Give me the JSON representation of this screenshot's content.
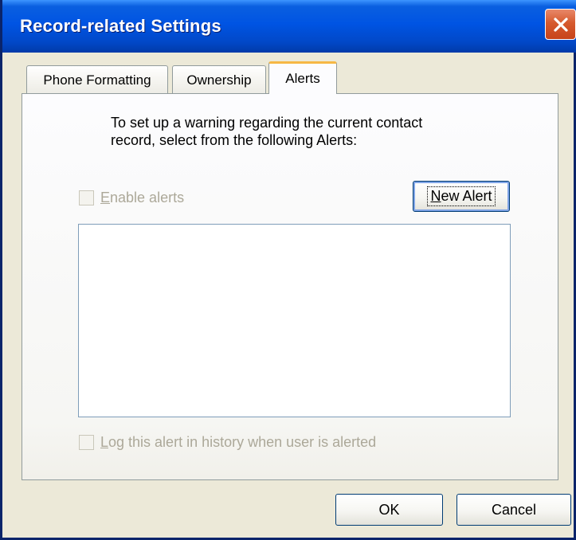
{
  "window": {
    "title": "Record-related Settings",
    "close_icon": "close-icon",
    "title_color": "#0054e3",
    "close_color": "#d65a2e"
  },
  "tabs": [
    {
      "label": "Phone Formatting",
      "active": false
    },
    {
      "label": "Ownership",
      "active": false
    },
    {
      "label": "Alerts",
      "active": true
    }
  ],
  "alerts": {
    "description_line1": "To set up a warning regarding the current contact",
    "description_line2": "record, select from the following Alerts:",
    "enable_alerts": {
      "label_mnemonic": "E",
      "label_rest": "nable alerts",
      "checked": false,
      "enabled": false
    },
    "new_alert_button": {
      "label_mnemonic": "N",
      "label_rest": "ew Alert"
    },
    "alerts_list": [],
    "log_alert": {
      "label_mnemonic": "L",
      "label_rest": "og this alert in history when user is alerted",
      "checked": false,
      "enabled": false
    }
  },
  "footer": {
    "ok_label": "OK",
    "cancel_label": "Cancel"
  }
}
